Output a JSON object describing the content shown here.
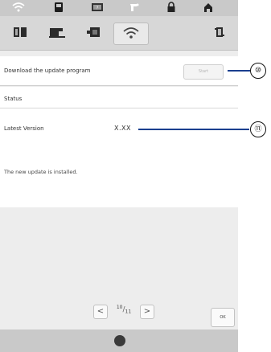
{
  "top_tabs": [
    {
      "icon": "wifi-icon"
    },
    {
      "icon": "memory-card-icon"
    },
    {
      "icon": "screen-icon"
    },
    {
      "icon": "pointer-icon"
    },
    {
      "icon": "lock-icon"
    },
    {
      "icon": "home-icon"
    }
  ],
  "sub_tabs": [
    {
      "icon": "book-icon"
    },
    {
      "icon": "sewing-machine-icon"
    },
    {
      "icon": "embroidery-unit-icon"
    },
    {
      "icon": "wifi-icon",
      "active": true
    },
    {
      "icon": "settings-icon"
    }
  ],
  "download": {
    "label": "Download the update program",
    "button_label": "Start"
  },
  "status": {
    "title": "Status",
    "latest_version_label": "Latest Version",
    "latest_version_value": "X.XX",
    "message": "The new update is installed."
  },
  "pager": {
    "prev": "<",
    "current": "10",
    "total": "11",
    "next": ">"
  },
  "ok_label": "OK",
  "callouts": {
    "ten": "⑩",
    "eleven": "⑪"
  },
  "colors": {
    "callout_line": "#1a3f8f",
    "screen_bg": "#ededed",
    "tab_bar": "#c9c9c9"
  }
}
